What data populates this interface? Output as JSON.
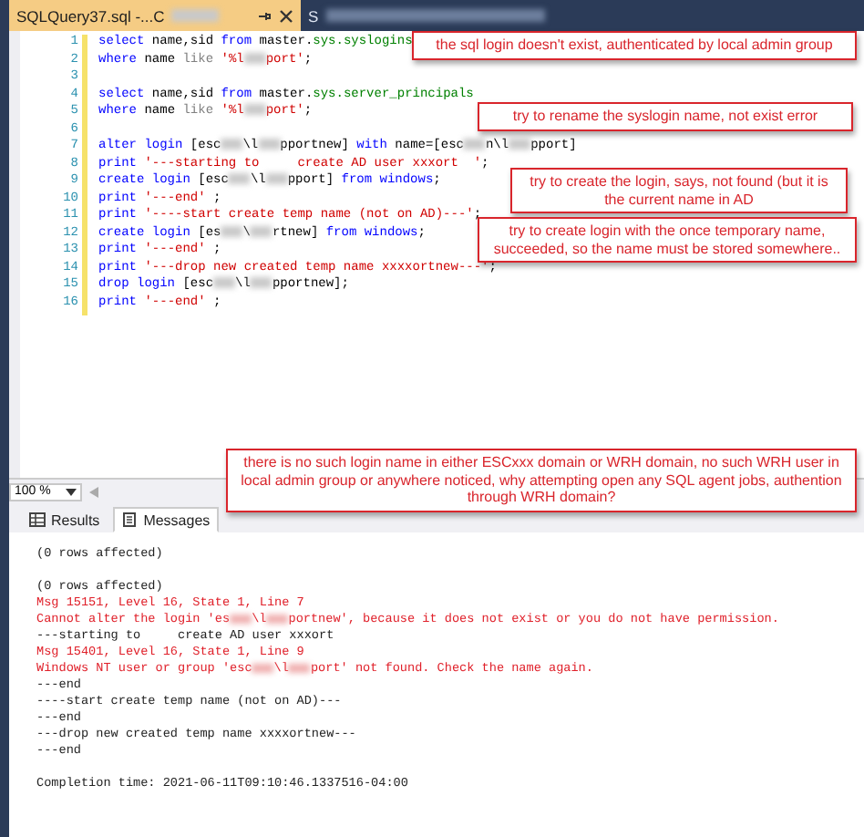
{
  "tabs": [
    {
      "title": "SQLQuery37.sql -...C",
      "selected": true,
      "redacted": true
    },
    {
      "title": "S",
      "selected": false,
      "redacted": true
    }
  ],
  "editor": {
    "lines": [
      {
        "number": "1",
        "tokens": [
          {
            "kind": "keyword",
            "text": "select"
          },
          {
            "kind": "plain",
            "text": " name,sid "
          },
          {
            "kind": "keyword",
            "text": "from"
          },
          {
            "kind": "plain",
            "text": " master."
          },
          {
            "kind": "object",
            "text": "sys.syslogins"
          }
        ]
      },
      {
        "number": "2",
        "tokens": [
          {
            "kind": "keyword",
            "text": "where"
          },
          {
            "kind": "plain",
            "text": " name "
          },
          {
            "kind": "operator",
            "text": "like"
          },
          {
            "kind": "string",
            "text": " '%l"
          },
          {
            "kind": "redacted"
          },
          {
            "kind": "string",
            "text": "port'"
          },
          {
            "kind": "plain",
            "text": ";"
          }
        ]
      },
      {
        "number": "3"
      },
      {
        "number": "4",
        "tokens": [
          {
            "kind": "keyword",
            "text": "select"
          },
          {
            "kind": "plain",
            "text": " name,sid "
          },
          {
            "kind": "keyword",
            "text": "from"
          },
          {
            "kind": "plain",
            "text": " master."
          },
          {
            "kind": "object",
            "text": "sys.server_principals"
          }
        ]
      },
      {
        "number": "5",
        "tokens": [
          {
            "kind": "keyword",
            "text": "where"
          },
          {
            "kind": "plain",
            "text": " name "
          },
          {
            "kind": "operator",
            "text": "like"
          },
          {
            "kind": "string",
            "text": " '%l"
          },
          {
            "kind": "redacted"
          },
          {
            "kind": "string",
            "text": "port'"
          },
          {
            "kind": "plain",
            "text": ";"
          }
        ]
      },
      {
        "number": "6"
      },
      {
        "number": "7",
        "tokens": [
          {
            "kind": "keyword",
            "text": "alter login"
          },
          {
            "kind": "plain",
            "text": " [esc"
          },
          {
            "kind": "redacted"
          },
          {
            "kind": "plain",
            "text": "\\l"
          },
          {
            "kind": "redacted"
          },
          {
            "kind": "plain",
            "text": "pportnew] "
          },
          {
            "kind": "keyword",
            "text": "with"
          },
          {
            "kind": "plain",
            "text": " name=[esc"
          },
          {
            "kind": "redacted"
          },
          {
            "kind": "plain",
            "text": "n\\l"
          },
          {
            "kind": "redacted"
          },
          {
            "kind": "plain",
            "text": "pport]"
          }
        ]
      },
      {
        "number": "8",
        "tokens": [
          {
            "kind": "keyword",
            "text": "print"
          },
          {
            "kind": "string",
            "text": " '---starting to     create AD user xxxort  '"
          },
          {
            "kind": "plain",
            "text": ";"
          }
        ]
      },
      {
        "number": "9",
        "tokens": [
          {
            "kind": "keyword",
            "text": "create login"
          },
          {
            "kind": "plain",
            "text": " [esc"
          },
          {
            "kind": "redacted"
          },
          {
            "kind": "plain",
            "text": "\\l"
          },
          {
            "kind": "redacted"
          },
          {
            "kind": "plain",
            "text": "pport] "
          },
          {
            "kind": "keyword",
            "text": "from windows"
          },
          {
            "kind": "plain",
            "text": ";"
          }
        ]
      },
      {
        "number": "10",
        "tokens": [
          {
            "kind": "keyword",
            "text": "print"
          },
          {
            "kind": "string",
            "text": " '---end'"
          },
          {
            "kind": "plain",
            "text": " ;"
          }
        ]
      },
      {
        "number": "11",
        "tokens": [
          {
            "kind": "keyword",
            "text": "print"
          },
          {
            "kind": "string",
            "text": " '----start create temp name (not on AD)---'"
          },
          {
            "kind": "plain",
            "text": ";"
          }
        ]
      },
      {
        "number": "12",
        "tokens": [
          {
            "kind": "keyword",
            "text": "create login"
          },
          {
            "kind": "plain",
            "text": " [es"
          },
          {
            "kind": "redacted"
          },
          {
            "kind": "plain",
            "text": "\\"
          },
          {
            "kind": "redacted"
          },
          {
            "kind": "plain",
            "text": "rtnew] "
          },
          {
            "kind": "keyword",
            "text": "from windows"
          },
          {
            "kind": "plain",
            "text": ";"
          }
        ]
      },
      {
        "number": "13",
        "tokens": [
          {
            "kind": "keyword",
            "text": "print"
          },
          {
            "kind": "string",
            "text": " '---end'"
          },
          {
            "kind": "plain",
            "text": " ;"
          }
        ]
      },
      {
        "number": "14",
        "tokens": [
          {
            "kind": "keyword",
            "text": "print"
          },
          {
            "kind": "string",
            "text": " '---drop new created temp name xxxxortnew---'"
          },
          {
            "kind": "plain",
            "text": ";"
          }
        ]
      },
      {
        "number": "15",
        "tokens": [
          {
            "kind": "keyword",
            "text": "drop login"
          },
          {
            "kind": "plain",
            "text": " [esc"
          },
          {
            "kind": "redacted"
          },
          {
            "kind": "plain",
            "text": "\\l"
          },
          {
            "kind": "redacted"
          },
          {
            "kind": "plain",
            "text": "pportnew];"
          }
        ]
      },
      {
        "number": "16",
        "tokens": [
          {
            "kind": "keyword",
            "text": "print"
          },
          {
            "kind": "string",
            "text": " '---end'"
          },
          {
            "kind": "plain",
            "text": " ;"
          }
        ]
      }
    ]
  },
  "annotations": [
    {
      "text": "the sql login doesn't exist, authenticated by local admin group"
    },
    {
      "text": "try to rename the syslogin name, not exist error"
    },
    {
      "text": "try to create the login, says, not found (but it is the current name in AD"
    },
    {
      "text": "try to create login with the once temporary name, succeeded, so the name must be stored somewhere.."
    },
    {
      "text": "there is no such login name in either ESCxxx domain or WRH domain, no such WRH user in local admin group or anywhere noticed, why attempting open any SQL agent jobs, authention through WRH domain?"
    }
  ],
  "zoom": {
    "value": "100 %"
  },
  "result_tabs": [
    {
      "label": "Results",
      "selected": false,
      "kind": "grid"
    },
    {
      "label": "Messages",
      "selected": true,
      "kind": "messages"
    }
  ],
  "messages": [
    {
      "kind": "normal",
      "parts": [
        {
          "kind": "text",
          "text": "(0 rows affected)"
        }
      ]
    },
    {
      "kind": "blank"
    },
    {
      "kind": "normal",
      "parts": [
        {
          "kind": "text",
          "text": "(0 rows affected)"
        }
      ]
    },
    {
      "kind": "error",
      "parts": [
        {
          "kind": "text",
          "text": "Msg 15151, Level 16, State 1, Line 7"
        }
      ]
    },
    {
      "kind": "error",
      "parts": [
        {
          "kind": "text",
          "text": "Cannot alter the login 'es"
        },
        {
          "kind": "redacted"
        },
        {
          "kind": "text",
          "text": "\\l"
        },
        {
          "kind": "redacted"
        },
        {
          "kind": "text",
          "text": "portnew', because it does not exist or you do not have permission."
        }
      ]
    },
    {
      "kind": "normal",
      "parts": [
        {
          "kind": "text",
          "text": "---starting to     create AD user xxxort"
        }
      ]
    },
    {
      "kind": "error",
      "parts": [
        {
          "kind": "text",
          "text": "Msg 15401, Level 16, State 1, Line 9"
        }
      ]
    },
    {
      "kind": "error",
      "parts": [
        {
          "kind": "text",
          "text": "Windows NT user or group 'esc"
        },
        {
          "kind": "redacted"
        },
        {
          "kind": "text",
          "text": "\\l"
        },
        {
          "kind": "redacted"
        },
        {
          "kind": "text",
          "text": "port' not found. Check the name again."
        }
      ]
    },
    {
      "kind": "normal",
      "parts": [
        {
          "kind": "text",
          "text": "---end"
        }
      ]
    },
    {
      "kind": "normal",
      "parts": [
        {
          "kind": "text",
          "text": "----start create temp name (not on AD)---"
        }
      ]
    },
    {
      "kind": "normal",
      "parts": [
        {
          "kind": "text",
          "text": "---end"
        }
      ]
    },
    {
      "kind": "normal",
      "parts": [
        {
          "kind": "text",
          "text": "---drop new created temp name xxxxortnew---"
        }
      ]
    },
    {
      "kind": "normal",
      "parts": [
        {
          "kind": "text",
          "text": "---end"
        }
      ]
    },
    {
      "kind": "blank"
    },
    {
      "kind": "normal",
      "parts": [
        {
          "kind": "text",
          "text": "Completion time: 2021-06-11T09:10:46.1337516-04:00"
        }
      ]
    }
  ]
}
